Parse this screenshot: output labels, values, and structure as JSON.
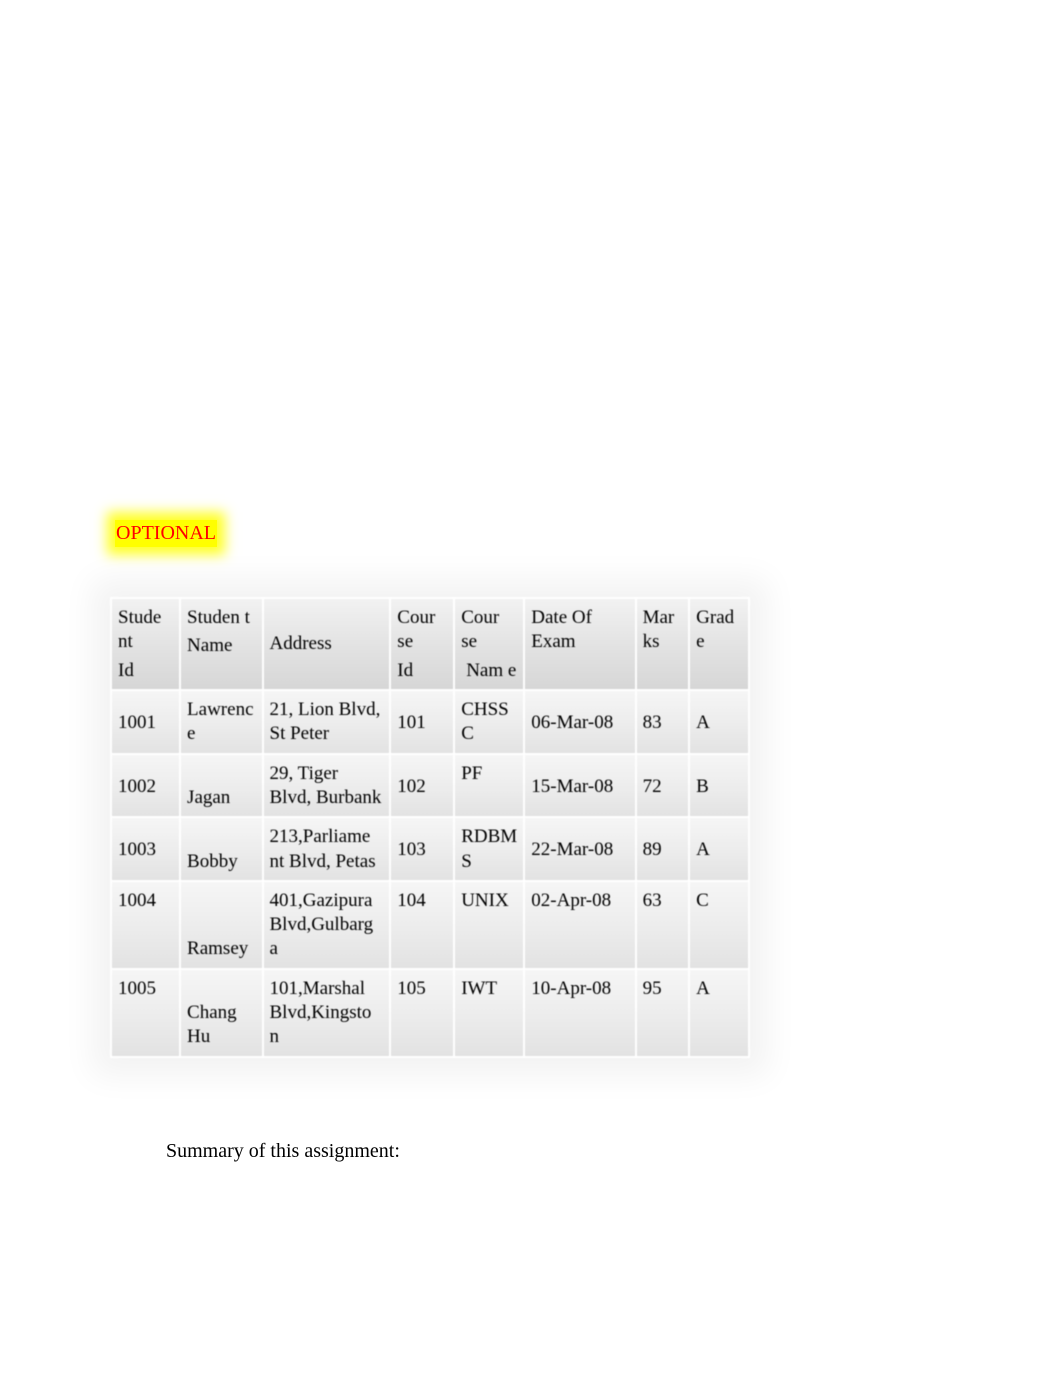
{
  "label": {
    "optional": "OPTIONAL"
  },
  "table": {
    "headers": {
      "student_id_l1": "Stude nt",
      "student_id_l2": "Id",
      "student_name_l1": "Studen t",
      "student_name_l2": "Name",
      "address": "Address",
      "course_id_l1": "Cour se",
      "course_id_l2": "Id",
      "course_name_l1": "Cour se",
      "course_name_l2": "Nam e",
      "date_of_exam": "Date Of Exam",
      "marks": "Mar ks",
      "grade": "Grad e"
    },
    "rows": [
      {
        "student_id": "1001",
        "student_name": "Lawrenc e",
        "address": "21, Lion Blvd, St Peter",
        "course_id": "101",
        "course_name": "CHSS C",
        "date_of_exam": "06-Mar-08",
        "marks": "83",
        "grade": "A"
      },
      {
        "student_id": "1002",
        "student_name": "Jagan",
        "address": "29, Tiger Blvd, Burbank",
        "course_id": "102",
        "course_name": "PF",
        "date_of_exam": "15-Mar-08",
        "marks": "72",
        "grade": "B"
      },
      {
        "student_id": "1003",
        "student_name": "Bobby",
        "address": "213,Parliame nt Blvd, Petas",
        "course_id": "103",
        "course_name": "RDBM S",
        "date_of_exam": "22-Mar-08",
        "marks": "89",
        "grade": "A"
      },
      {
        "student_id": "1004",
        "student_name": "Ramsey",
        "address": "401,Gazipura Blvd,Gulbarg a",
        "course_id": "104",
        "course_name": "UNIX",
        "date_of_exam": "02-Apr-08",
        "marks": "63",
        "grade": "C"
      },
      {
        "student_id": "1005",
        "student_name": "Chang Hu",
        "address": "101,Marshal Blvd,Kingsto n",
        "course_id": "105",
        "course_name": "IWT",
        "date_of_exam": "10-Apr-08",
        "marks": "95",
        "grade": "A"
      }
    ]
  },
  "summary_text": "Summary of this assignment:"
}
